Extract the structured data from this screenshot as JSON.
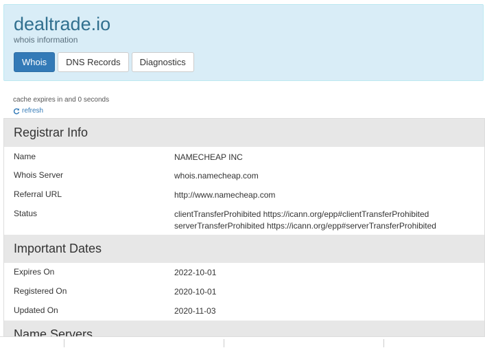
{
  "header": {
    "title": "dealtrade.io",
    "subtitle": "whois information",
    "tabs": [
      {
        "label": "Whois"
      },
      {
        "label": "DNS Records"
      },
      {
        "label": "Diagnostics"
      }
    ]
  },
  "cache": {
    "text": "cache expires in and 0 seconds",
    "refresh_label": "refresh"
  },
  "sections": {
    "registrar": {
      "title": "Registrar Info",
      "rows": [
        {
          "key": "Name",
          "value": "NAMECHEAP INC"
        },
        {
          "key": "Whois Server",
          "value": "whois.namecheap.com"
        },
        {
          "key": "Referral URL",
          "value": "http://www.namecheap.com"
        },
        {
          "key": "Status",
          "value": [
            "clientTransferProhibited https://icann.org/epp#clientTransferProhibited",
            "serverTransferProhibited https://icann.org/epp#serverTransferProhibited"
          ]
        }
      ]
    },
    "dates": {
      "title": "Important Dates",
      "rows": [
        {
          "key": "Expires On",
          "value": "2022-10-01"
        },
        {
          "key": "Registered On",
          "value": "2020-10-01"
        },
        {
          "key": "Updated On",
          "value": "2020-11-03"
        }
      ]
    },
    "nameservers": {
      "title": "Name Servers"
    }
  },
  "icons": {
    "refresh": "refresh-icon"
  },
  "colors": {
    "header_bg": "#d9edf7",
    "title": "#31708f",
    "active_tab": "#337ab7",
    "section_bg": "#e7e7e7"
  }
}
